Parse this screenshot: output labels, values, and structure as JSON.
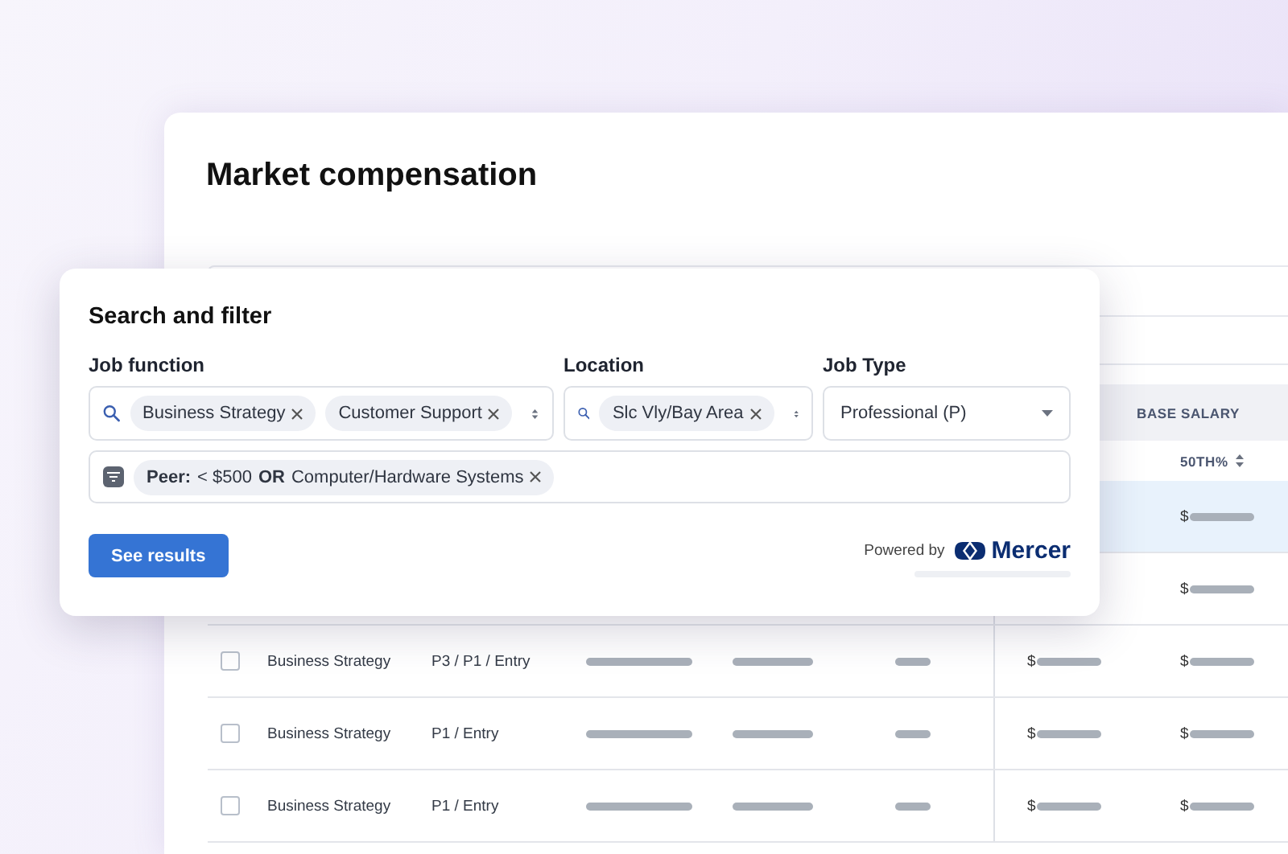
{
  "page": {
    "title": "Market compensation"
  },
  "table": {
    "header": {
      "group": "BASE SALARY",
      "sort_column": "50TH%"
    },
    "rows": [
      {
        "selected": true,
        "salary_50th": "$"
      },
      {
        "selected": false,
        "salary_50th": "$"
      },
      {
        "selected": false,
        "checked": false,
        "job_function": "Business Strategy",
        "level": "P3 / P1 / Entry",
        "salary_1": "$",
        "salary_50th": "$"
      },
      {
        "selected": false,
        "checked": false,
        "job_function": "Business Strategy",
        "level": "P1 / Entry",
        "salary_1": "$",
        "salary_50th": "$"
      },
      {
        "selected": false,
        "checked": false,
        "job_function": "Business Strategy",
        "level": "P1 / Entry",
        "salary_1": "$",
        "salary_50th": "$"
      }
    ]
  },
  "search_panel": {
    "title": "Search and filter",
    "job_function": {
      "label": "Job function",
      "chips": [
        "Business Strategy",
        "Customer Support"
      ]
    },
    "location": {
      "label": "Location",
      "chips": [
        "Slc Vly/Bay Area"
      ]
    },
    "job_type": {
      "label": "Job Type",
      "value": "Professional (P)"
    },
    "peer_filter": "**Peer:** < $500 **OR** Computer/Hardware Systems",
    "button": "See results",
    "powered_by": "Powered by",
    "brand": "Mercer"
  }
}
